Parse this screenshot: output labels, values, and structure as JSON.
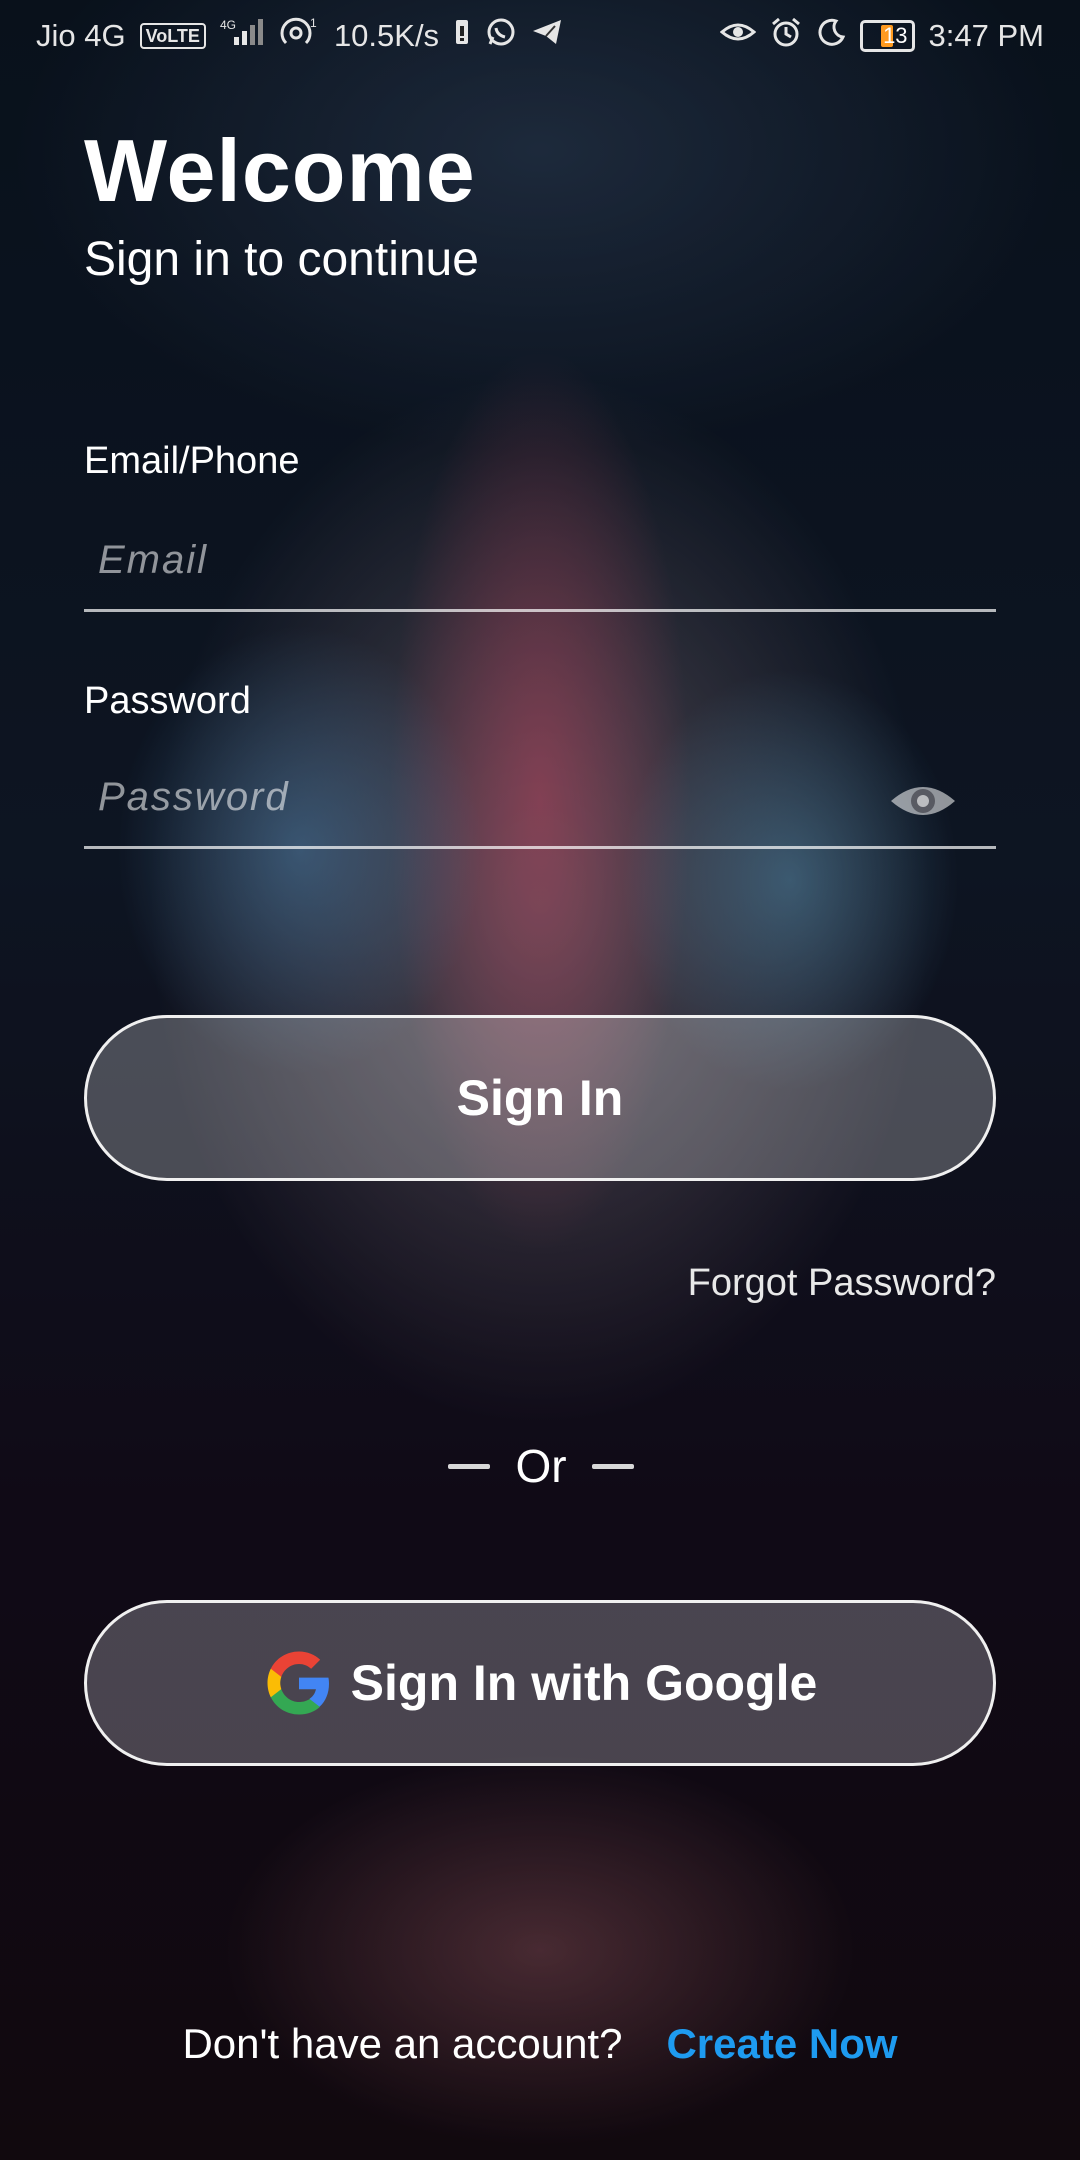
{
  "status_bar": {
    "carrier": "Jio 4G",
    "volte": "VoLTE",
    "network": "4G",
    "hotspot_count": "1",
    "speed": "10.5K/s",
    "battery": "13",
    "time": "3:47 PM"
  },
  "header": {
    "title": "Welcome",
    "subtitle": "Sign in to continue"
  },
  "form": {
    "email_label": "Email/Phone",
    "email_placeholder": "Email",
    "email_value": "",
    "password_label": "Password",
    "password_placeholder": "Password",
    "password_value": "",
    "signin_label": "Sign In",
    "forgot_label": "Forgot Password?",
    "or_label": "Or",
    "google_label": "Sign In with Google"
  },
  "footer": {
    "prompt": "Don't have an account?",
    "create_label": "Create Now"
  },
  "colors": {
    "accent": "#1e9bf0",
    "battery": "#ff9a1f"
  }
}
